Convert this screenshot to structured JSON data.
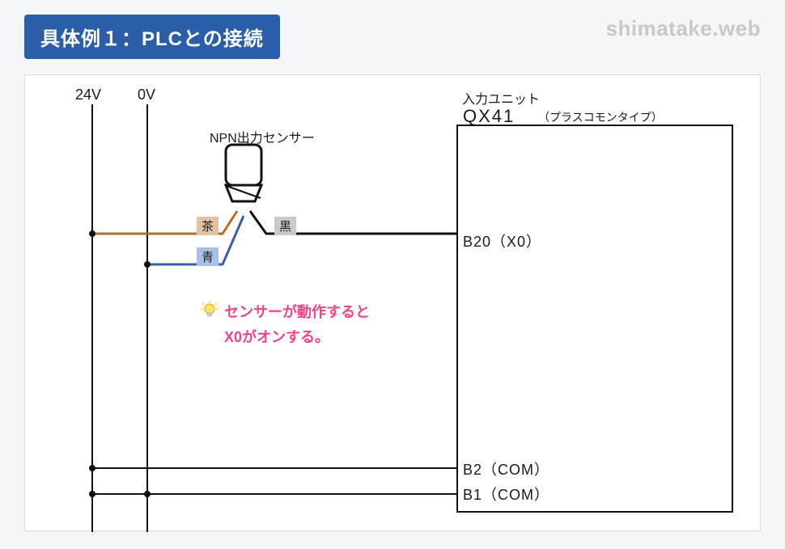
{
  "title": "具体例１：PLCとの接続",
  "watermark": "shimatake.web",
  "rails": {
    "label_24v": "24V",
    "label_0v": "0V"
  },
  "sensor": {
    "title": "NPN出力センサー"
  },
  "wires": {
    "brown": "茶",
    "blue": "青",
    "black": "黒"
  },
  "unit": {
    "header": "入力ユニット",
    "model": "QX41",
    "subtitle": "（プラスコモンタイプ）",
    "terminals": {
      "b20": "B20（X0）",
      "b2": "B2（COM）",
      "b1": "B1（COM）"
    }
  },
  "callout": {
    "line1": "センサーが動作すると",
    "line2": "X0がオンする。"
  }
}
